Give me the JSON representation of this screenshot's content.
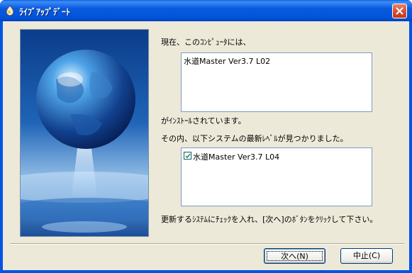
{
  "window": {
    "title": "ﾗｲﾌﾞｱｯﾌﾟﾃﾞｰﾄ"
  },
  "content": {
    "current_label": "現在、このｺﾝﾋﾟｭｰﾀには、",
    "installed_systems": [
      "水道Master Ver3.7 L02"
    ],
    "installed_suffix": "がｲﾝｽﾄｰﾙされています。",
    "found_label": "その内、以下システムの最新ﾚﾍﾞﾙが見つかりました。",
    "updates": [
      {
        "label": "水道Master Ver3.7 L04",
        "checked": true
      }
    ],
    "instruction": "更新するｼｽﾃﾑにﾁｪｯｸを入れ、[次へ]のﾎﾞﾀﾝをｸﾘｯｸして下さい。"
  },
  "buttons": {
    "next": "次へ(N)",
    "cancel": "中止(C)"
  }
}
